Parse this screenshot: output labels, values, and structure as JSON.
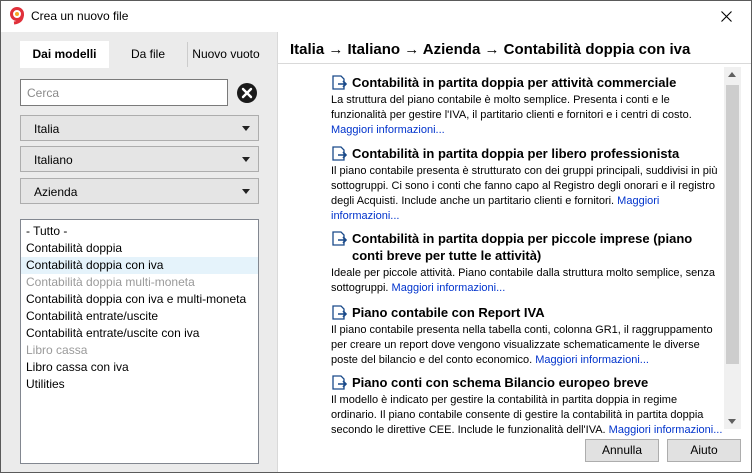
{
  "window": {
    "title": "Crea un nuovo file",
    "accent_color": "#e0303a"
  },
  "tabs": [
    {
      "label": "Dai modelli",
      "active": true
    },
    {
      "label": "Da file",
      "active": false
    },
    {
      "label": "Nuovo vuoto",
      "active": false
    }
  ],
  "search": {
    "placeholder": "Cerca",
    "value": ""
  },
  "filters": {
    "country": "Italia",
    "language": "Italiano",
    "type": "Azienda"
  },
  "categories": [
    {
      "label": "- Tutto -",
      "enabled": true,
      "selected": false
    },
    {
      "label": "Contabilità doppia",
      "enabled": true,
      "selected": false
    },
    {
      "label": "Contabilità doppia con iva",
      "enabled": true,
      "selected": true
    },
    {
      "label": "Contabilità doppia multi-moneta",
      "enabled": false,
      "selected": false
    },
    {
      "label": "Contabilità doppia con iva e multi-moneta",
      "enabled": true,
      "selected": false
    },
    {
      "label": "Contabilità entrate/uscite",
      "enabled": true,
      "selected": false
    },
    {
      "label": "Contabilità entrate/uscite con iva",
      "enabled": true,
      "selected": false
    },
    {
      "label": "Libro cassa",
      "enabled": false,
      "selected": false
    },
    {
      "label": "Libro cassa con iva",
      "enabled": true,
      "selected": false
    },
    {
      "label": "Utilities",
      "enabled": true,
      "selected": false
    }
  ],
  "breadcrumb": "Italia → Italiano → Azienda → Contabilità doppia con iva",
  "templates": [
    {
      "title": "Contabilità in partita doppia per attività commerciale",
      "description": "La struttura del piano contabile è molto semplice. Presenta i conti e le funzionalità per gestire l'IVA, il partitario clienti e fornitori e i centri di costo.",
      "link": "Maggiori informazioni..."
    },
    {
      "title": "Contabilità in partita doppia per libero professionista",
      "description": "Il piano contabile presenta è strutturato con dei gruppi principali, suddivisi in più sottogruppi. Ci sono i conti che fanno capo al Registro degli onorari e il registro degli Acquisti. Include anche un partitario clienti e fornitori.",
      "link": "Maggiori informazioni..."
    },
    {
      "title": "Contabilità in partita doppia per piccole imprese (piano conti breve per tutte le attività)",
      "description": "Ideale per piccole attività. Piano contabile dalla struttura molto semplice, senza sottogruppi.",
      "link": "Maggiori informazioni..."
    },
    {
      "title": "Piano contabile con Report IVA",
      "description": "Il piano contabile presenta nella tabella conti, colonna GR1, il raggruppamento per creare un report dove vengono visualizzate schematicamente le diverse poste del bilancio e del conto economico.",
      "link": "Maggiori informazioni..."
    },
    {
      "title": "Piano conti con schema Bilancio europeo breve",
      "description": "Il modello è indicato per gestire la contabilità in partita doppia in regime ordinario. Il piano contabile consente di gestire la contabilità in partita doppia secondo le direttive CEE. Include le funzionalità dell'IVA.",
      "link": "Maggiori informazioni..."
    }
  ],
  "buttons": {
    "cancel": "Annulla",
    "help": "Aiuto"
  }
}
